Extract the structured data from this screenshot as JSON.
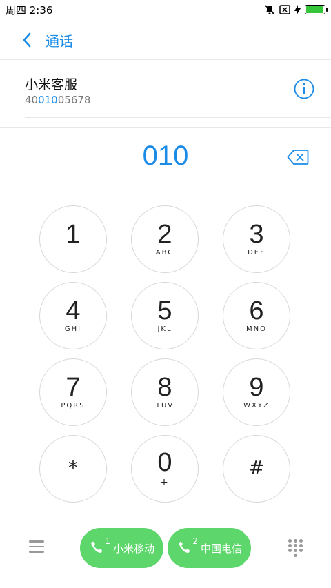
{
  "status_bar": {
    "time": "周四 2:36",
    "icons": [
      "mute-icon",
      "no-sim-icon",
      "charging-icon",
      "battery-icon"
    ]
  },
  "header": {
    "title": "通话"
  },
  "contact": {
    "name": "小米客服",
    "number_prefix": "40",
    "number_match": "010",
    "number_suffix": "05678"
  },
  "dialed_number": "010",
  "keypad": [
    {
      "digit": "1",
      "letters": ""
    },
    {
      "digit": "2",
      "letters": "ABC"
    },
    {
      "digit": "3",
      "letters": "DEF"
    },
    {
      "digit": "4",
      "letters": "GHI"
    },
    {
      "digit": "5",
      "letters": "JKL"
    },
    {
      "digit": "6",
      "letters": "MNO"
    },
    {
      "digit": "7",
      "letters": "PQRS"
    },
    {
      "digit": "8",
      "letters": "TUV"
    },
    {
      "digit": "9",
      "letters": "WXYZ"
    },
    {
      "digit": "*",
      "letters": ""
    },
    {
      "digit": "0",
      "letters": "+"
    },
    {
      "digit": "#",
      "letters": ""
    }
  ],
  "calls": [
    {
      "sim": "1",
      "label": "小米移动"
    },
    {
      "sim": "2",
      "label": "中国电信"
    }
  ],
  "colors": {
    "accent": "#1a8ce8",
    "call_green": "#5dd66c",
    "battery_green": "#35c53a"
  }
}
